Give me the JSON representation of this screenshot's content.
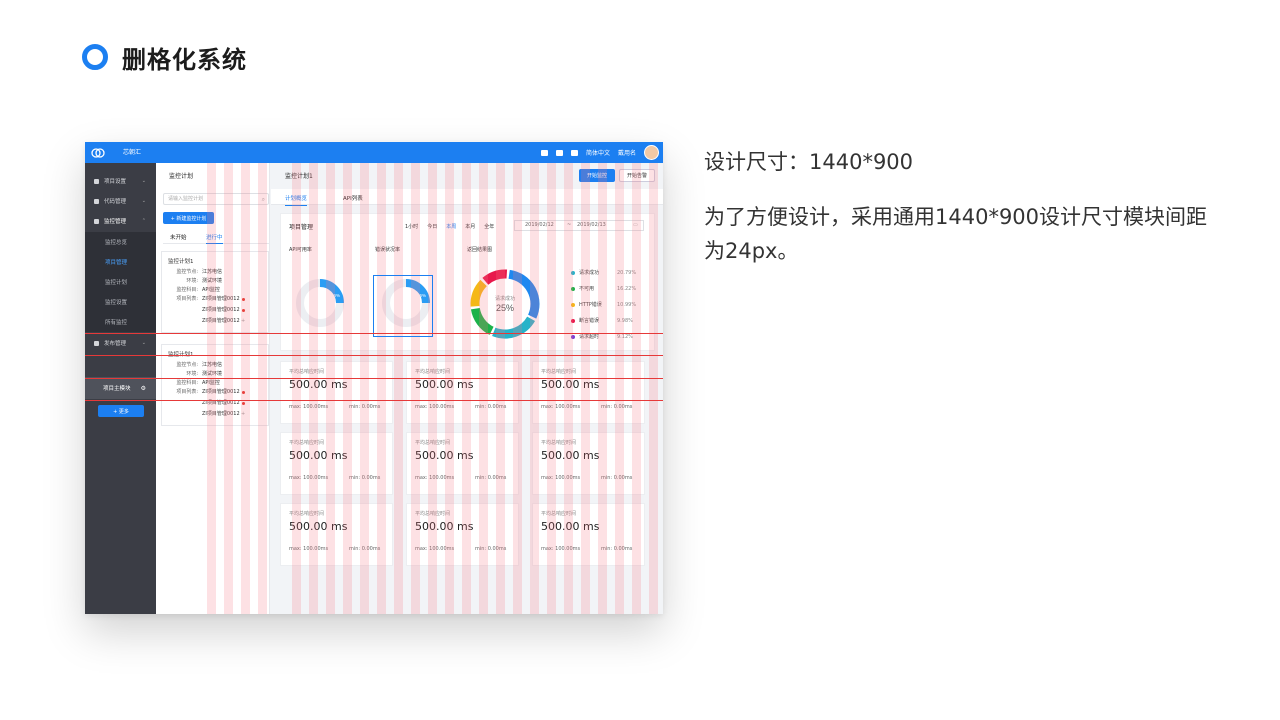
{
  "slide": {
    "title": "删格化系统",
    "size_text": "设计尺寸：1440*900",
    "desc_text": "为了方便设计，采用通用1440*900设计尺寸模块间距为24px。"
  },
  "colors": {
    "primary": "#1c7ff1",
    "grid_red": "#e63939",
    "sidebar": "#3b3d45"
  },
  "mock": {
    "brand": "芯朝汇",
    "top_right": {
      "lang": "简体中文",
      "user": "戴用名"
    },
    "sidebar": {
      "items": [
        {
          "label": "项目设置",
          "icon": "gear-icon"
        },
        {
          "label": "代码管理",
          "icon": "flag-icon"
        },
        {
          "label": "监控管理",
          "icon": "chart-icon"
        }
      ],
      "subs": [
        "监控总览",
        "项目管理",
        "监控计划",
        "监控设置",
        "所有监控"
      ],
      "publish": "发布管理",
      "main_module": "项目主模块",
      "more_button": "+ 更多"
    },
    "col2": {
      "title": "监控计划",
      "search_placeholder": "请输入监控计划",
      "new_button": "+ 新建监控计划",
      "tabs": [
        "未开始",
        "进行中"
      ],
      "cards": [
        {
          "title": "监控计划1",
          "node_k": "监控节点:",
          "node_v": "江苏电信",
          "env_k": "环境:",
          "env_v": "测试环境",
          "subject_k": "监控科目:",
          "subject_v": "API监控",
          "list_k": "项目列表:",
          "projects": [
            "ZI项目管理0012",
            "ZI项目管理0012",
            "ZI项目管理0012"
          ]
        },
        {
          "title": "监控计划1",
          "node_k": "监控节点:",
          "node_v": "江苏电信",
          "env_k": "环境:",
          "env_v": "测试环境",
          "subject_k": "监控科目:",
          "subject_v": "API监控",
          "list_k": "项目列表:",
          "projects": [
            "ZI项目管理0012",
            "ZI项目管理0012",
            "ZI项目管理0012"
          ]
        }
      ]
    },
    "main": {
      "title": "监控计划1",
      "btn_start": "开始监控",
      "btn_alert": "开始告警",
      "tabs": [
        "计划概览",
        "API列表"
      ],
      "panel": {
        "title": "项目管理",
        "ranges": [
          "1小时",
          "今日",
          "本周",
          "本月",
          "全年"
        ],
        "date_from": "2019/02/12",
        "date_sep": "~",
        "date_to": "2019/02/13",
        "api_label": "API可用率",
        "error_label": "错误状况率",
        "result_label": "返回结果图",
        "pie1_pct": "26%",
        "pie2_pct": "26%",
        "donut_label": "请求成功",
        "donut_pct": "25%"
      },
      "legend": [
        {
          "name": "请求成功",
          "pct": "20.79%",
          "color": "#28b3c9"
        },
        {
          "name": "不可用",
          "pct": "16.22%",
          "color": "#1cb24a"
        },
        {
          "name": "HTTP错误",
          "pct": "10.99%",
          "color": "#f5b817"
        },
        {
          "name": "断言错误",
          "pct": "9.98%",
          "color": "#e8194c"
        },
        {
          "name": "请求超时",
          "pct": "9.12%",
          "color": "#7a3fd1"
        }
      ],
      "stat": {
        "label": "平均总响应时间",
        "value": "500.00 ms",
        "max": "max:  100.00ms",
        "min": "min:   0.00ms"
      }
    }
  },
  "chart_data": {
    "type": "pie",
    "title": "返回结果图",
    "categories": [
      "请求成功",
      "不可用",
      "HTTP错误",
      "断言错误",
      "请求超时"
    ],
    "values": [
      20.79,
      16.22,
      10.99,
      9.98,
      9.12
    ]
  }
}
